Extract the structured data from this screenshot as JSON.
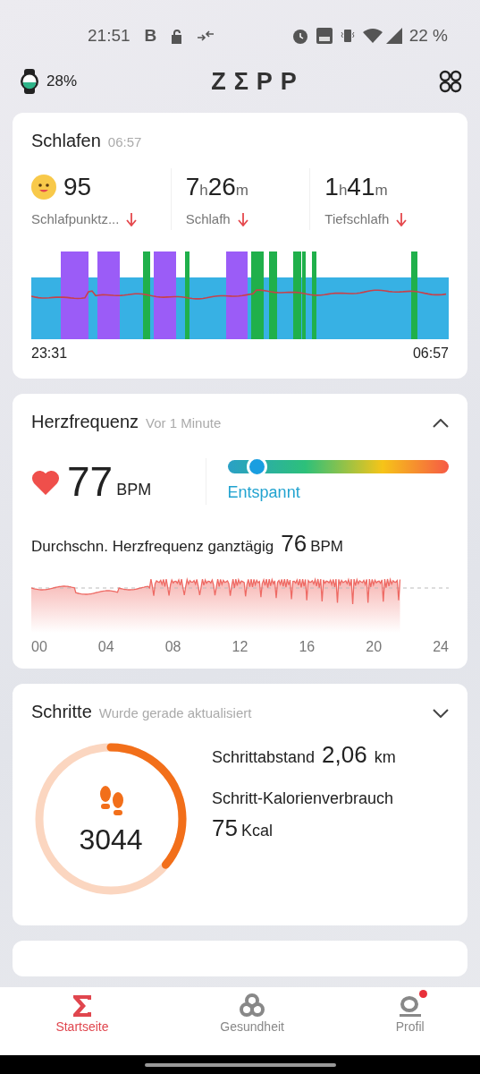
{
  "status_bar": {
    "time": "21:51",
    "carrier_letter": "B",
    "battery": "22 %"
  },
  "header": {
    "watch_battery": "28%",
    "logo": "ZΣPP"
  },
  "sleep": {
    "title": "Schlafen",
    "subtitle": "06:57",
    "metrics": [
      {
        "kind": "score",
        "parts": [
          {
            "text": "95",
            "kind": "num"
          }
        ],
        "label": "Schlafpunktz...",
        "trend_down": true
      },
      {
        "kind": "duration",
        "parts": [
          {
            "text": "7",
            "kind": "num"
          },
          {
            "text": "h",
            "kind": "unit"
          },
          {
            "text": "26",
            "kind": "num"
          },
          {
            "text": "m",
            "kind": "unit"
          }
        ],
        "label": "Schlafh",
        "trend_down": true
      },
      {
        "kind": "duration",
        "parts": [
          {
            "text": "1",
            "kind": "num"
          },
          {
            "text": "h",
            "kind": "unit"
          },
          {
            "text": "41",
            "kind": "num"
          },
          {
            "text": "m",
            "kind": "unit"
          }
        ],
        "label": "Tiefschlafh",
        "trend_down": true
      }
    ],
    "start": "23:31",
    "end": "06:57"
  },
  "heart": {
    "title": "Herzfrequenz",
    "subtitle": "Vor 1 Minute",
    "expanded": true,
    "bpm": "77",
    "unit": "BPM",
    "level": 0.13,
    "zone": "Entspannt",
    "average_label": "Durchschn. Herzfrequenz ganztägig",
    "average": "76",
    "average_unit": "BPM",
    "x_labels": [
      "00",
      "04",
      "08",
      "12",
      "16",
      "20",
      "24"
    ]
  },
  "steps": {
    "title": "Schritte",
    "subtitle": "Wurde gerade aktualisiert",
    "expanded": false,
    "count": "3044",
    "level": 0.36,
    "distance_label": "Schrittabstand",
    "distance": "2,06",
    "distance_unit": "km",
    "calories_label": "Schritt-Kalorienverbrauch",
    "calories": "75",
    "calories_unit": "Kcal"
  },
  "nav": [
    {
      "label": "Startseite",
      "selected": true,
      "badge": false
    },
    {
      "label": "Gesundheit",
      "selected": false,
      "badge": false
    },
    {
      "label": "Profil",
      "selected": false,
      "badge": true
    }
  ]
}
